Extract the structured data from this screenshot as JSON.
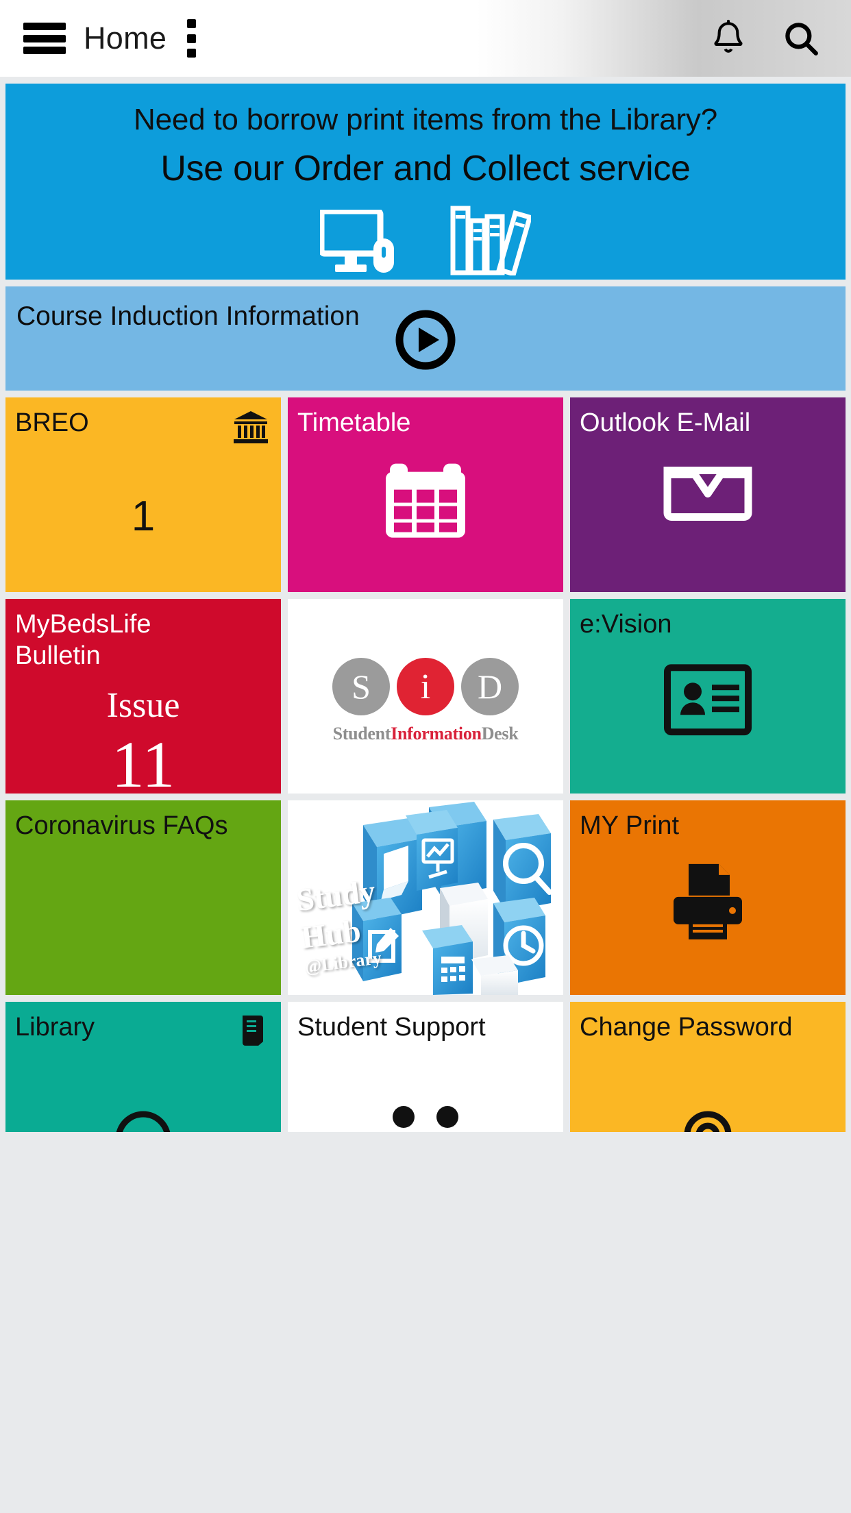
{
  "header": {
    "menu_icon": "hamburger-menu-icon",
    "title": "Home",
    "overflow_icon": "kebab-overflow-icon",
    "notification_icon": "bell-icon",
    "search_icon": "search-icon"
  },
  "banner": {
    "line1": "Need to borrow print items from the Library?",
    "line2": "Use our Order and Collect service",
    "bg_color": "#0d9ddb",
    "icons": [
      "monitor-mouse-icon",
      "books-icon"
    ]
  },
  "course_strip": {
    "label": "Course Induction Information",
    "bg_color": "#74b7e4",
    "play_icon": "play-circle-icon"
  },
  "tiles": [
    {
      "label": "BREO",
      "bg": "#fbb724",
      "text": "dark",
      "badge": "1",
      "corner_icon": "bank-building-icon"
    },
    {
      "label": "Timetable",
      "bg": "#d80f7d",
      "text": "light",
      "icon": "calendar-icon"
    },
    {
      "label": "Outlook E-Mail",
      "bg": "#6d2077",
      "text": "light",
      "icon": "inbox-tray-icon"
    },
    {
      "label": "MyBedsLife Bulletin",
      "bg": "#cf0a2c",
      "text": "light",
      "issue_word": "Issue",
      "issue_number": "11"
    },
    {
      "label": "",
      "bg": "#ffffff",
      "text": "dark",
      "logo": "student-information-desk-logo",
      "logo_letters": [
        "S",
        "i",
        "D"
      ],
      "caption": [
        {
          "t": "Student",
          "c": "grey"
        },
        {
          "t": "Information",
          "c": "red"
        },
        {
          "t": "Desk",
          "c": "grey"
        }
      ]
    },
    {
      "label": "e:Vision",
      "bg": "#14ad8f",
      "text": "dark",
      "icon": "id-card-icon"
    },
    {
      "label": "Coronavirus FAQs",
      "bg": "#64a613",
      "text": "dark"
    },
    {
      "label": "",
      "bg": "#ffffff",
      "text": "dark",
      "image": "study-hub-collage",
      "image_text": {
        "l1": "Study",
        "l2": "Hub",
        "l3": "@Library"
      }
    },
    {
      "label": "MY Print",
      "bg": "#ea7503",
      "text": "dark",
      "icon": "printer-icon"
    },
    {
      "label": "Library",
      "bg": "#0aab93",
      "text": "dark",
      "corner_icon": "book-icon"
    },
    {
      "label": "Student Support",
      "bg": "#ffffff",
      "text": "dark"
    },
    {
      "label": "Change Password",
      "bg": "#fbb724",
      "text": "dark"
    }
  ]
}
